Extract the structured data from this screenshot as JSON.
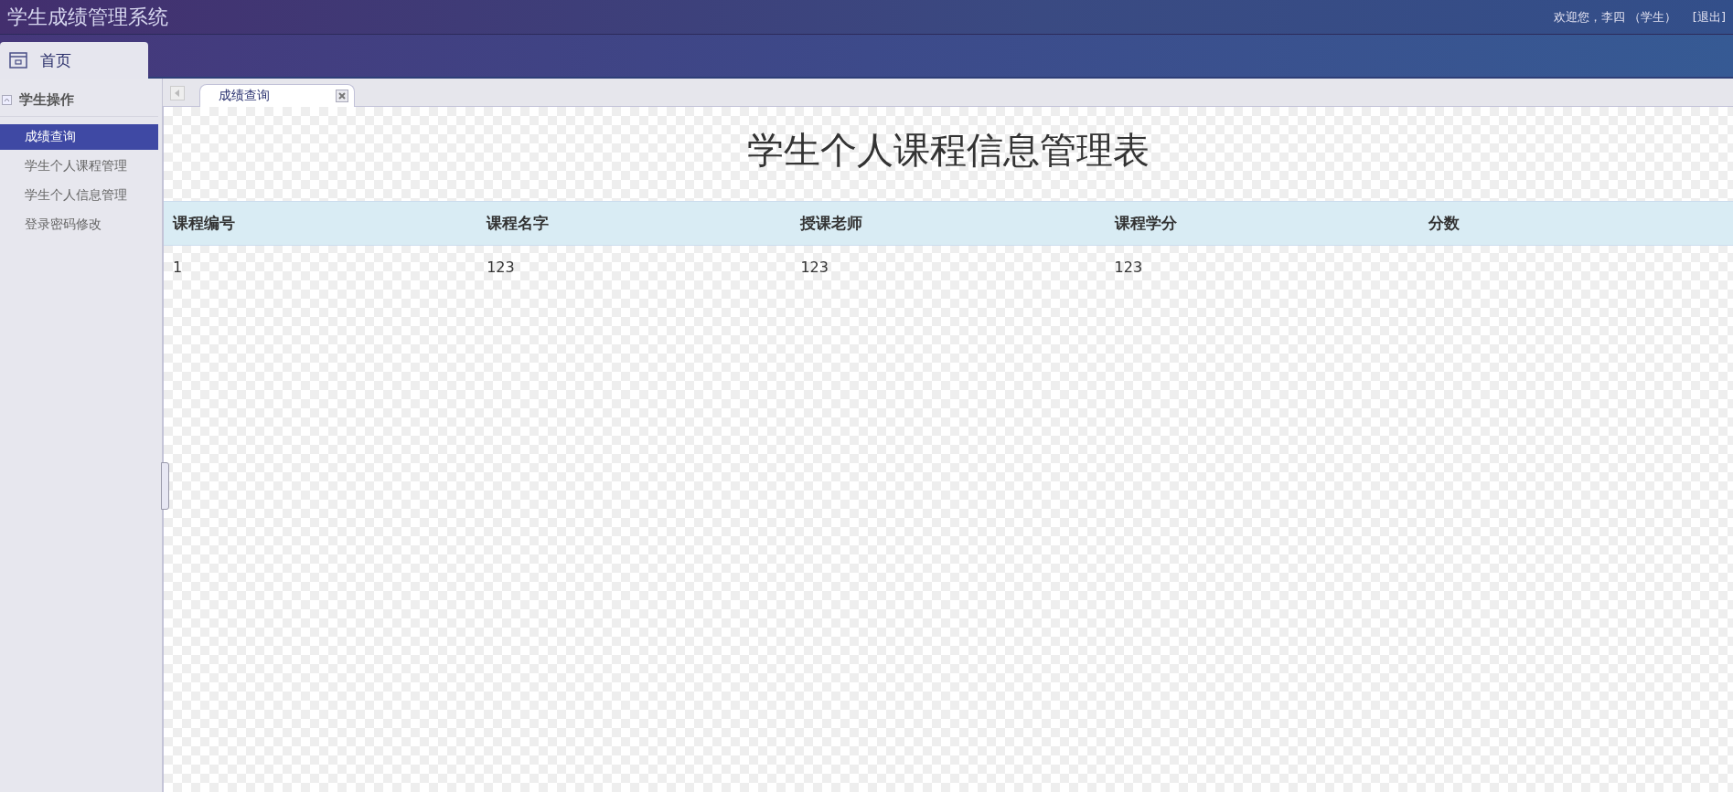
{
  "header": {
    "title": "学生成绩管理系统",
    "welcome": "欢迎您，李四 （学生）",
    "logout": "[退出]"
  },
  "nav_tabs": [
    {
      "label": "首页",
      "selected": true
    }
  ],
  "sidebar": {
    "section": {
      "label": "学生操作",
      "expanded": true
    },
    "items": [
      {
        "label": "成绩查询",
        "selected": true
      },
      {
        "label": "学生个人课程管理",
        "selected": false
      },
      {
        "label": "学生个人信息管理",
        "selected": false
      },
      {
        "label": "登录密码修改",
        "selected": false
      }
    ]
  },
  "content_tabs": [
    {
      "label": "成绩查询",
      "selected": true
    }
  ],
  "page": {
    "title": "学生个人课程信息管理表",
    "table": {
      "columns": [
        "课程编号",
        "课程名字",
        "授课老师",
        "课程学分",
        "分数"
      ],
      "rows": [
        [
          "1",
          "123",
          "123",
          "123",
          ""
        ]
      ]
    }
  }
}
